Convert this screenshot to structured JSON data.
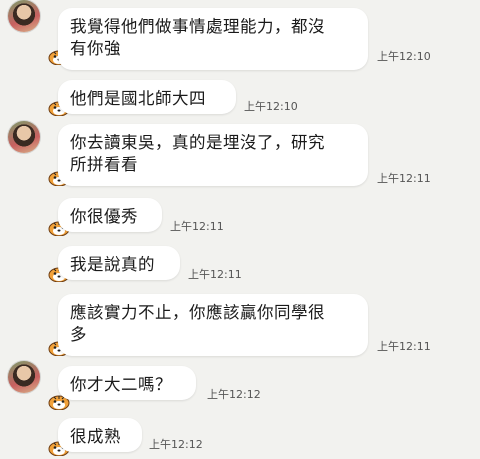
{
  "messages": [
    {
      "text": "我覺得他們做事情處理能力，都沒\n有你強",
      "time": "上午12:10",
      "avatar": "photo"
    },
    {
      "text": "他們是國北師大四",
      "time": "上午12:10",
      "avatar": "tiger"
    },
    {
      "text": "你去讀東吳，真的是埋沒了，研究\n所拼看看",
      "time": "上午12:11",
      "avatar": "photo"
    },
    {
      "text": "你很優秀",
      "time": "上午12:11",
      "avatar": "tiger"
    },
    {
      "text": "我是說真的",
      "time": "上午12:11",
      "avatar": "tiger"
    },
    {
      "text": "應該實力不止，你應該贏你同學很\n多",
      "time": "上午12:11",
      "avatar": "tiger"
    },
    {
      "text": "你才大二嗎？",
      "time": "上午12:12",
      "avatar": "photo"
    },
    {
      "text": "很成熟",
      "time": "上午12:12",
      "avatar": "tiger"
    }
  ],
  "icons": {
    "photo_avatar": "user-photo-avatar",
    "tiger_sticker": "tiger-face-icon"
  },
  "colors": {
    "background": "#f2f2ef",
    "bubble": "#ffffff",
    "text": "#1a1a1a",
    "time": "#555555"
  }
}
